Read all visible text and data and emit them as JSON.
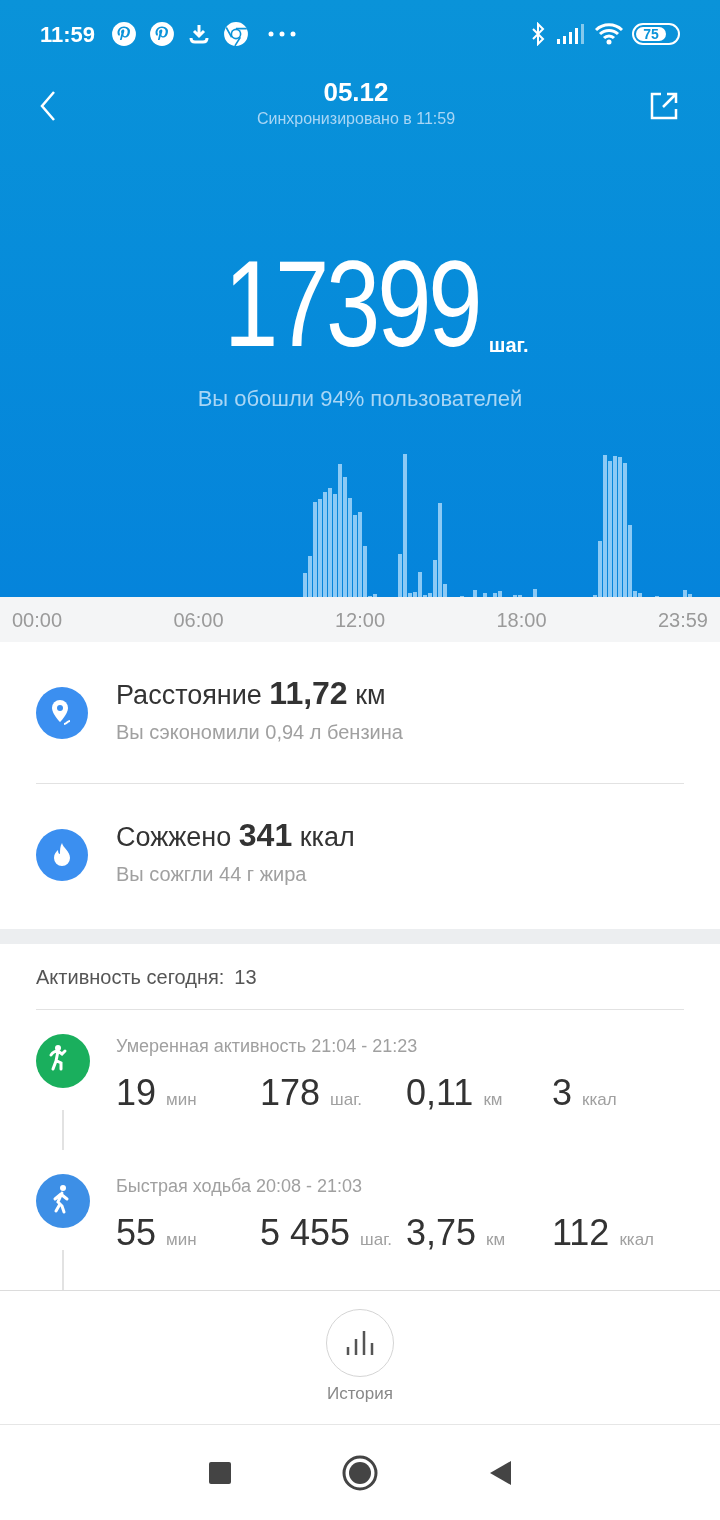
{
  "status_bar": {
    "time": "11:59",
    "battery": "75"
  },
  "header": {
    "title": "05.12",
    "subtitle": "Синхронизировано в 11:59"
  },
  "steps": {
    "count": "17399",
    "unit": "шаг.",
    "comparison": "Вы обошли 94% пользователей"
  },
  "timeline_labels": [
    "00:00",
    "06:00",
    "12:00",
    "18:00",
    "23:59"
  ],
  "summary": [
    {
      "kind": "distance",
      "title": "Расстояние **11,72** км",
      "subtitle": "Вы сэкономили 0,94 л бензина"
    },
    {
      "kind": "calories",
      "title": "Сожжено **341** ккал",
      "subtitle": "Вы сожгли 44 г жира"
    }
  ],
  "activity": {
    "label": "Активность сегодня:",
    "count": "13",
    "items": [
      {
        "kind": "moderate",
        "color": "#1aaf5d",
        "title": "Умеренная активность 21:04 - 21:23",
        "stats": [
          {
            "value": "19",
            "unit": "мин"
          },
          {
            "value": "178",
            "unit": "шаг."
          },
          {
            "value": "0,11",
            "unit": "км"
          },
          {
            "value": "3",
            "unit": "ккал"
          }
        ]
      },
      {
        "kind": "walk",
        "color": "#3d8fe6",
        "title": "Быстрая ходьба 20:08 - 21:03",
        "stats": [
          {
            "value": "55",
            "unit": "мин"
          },
          {
            "value": "5 455",
            "unit": "шаг."
          },
          {
            "value": "3,75",
            "unit": "км"
          },
          {
            "value": "112",
            "unit": "ккал"
          }
        ]
      }
    ]
  },
  "history": {
    "label": "История"
  }
}
